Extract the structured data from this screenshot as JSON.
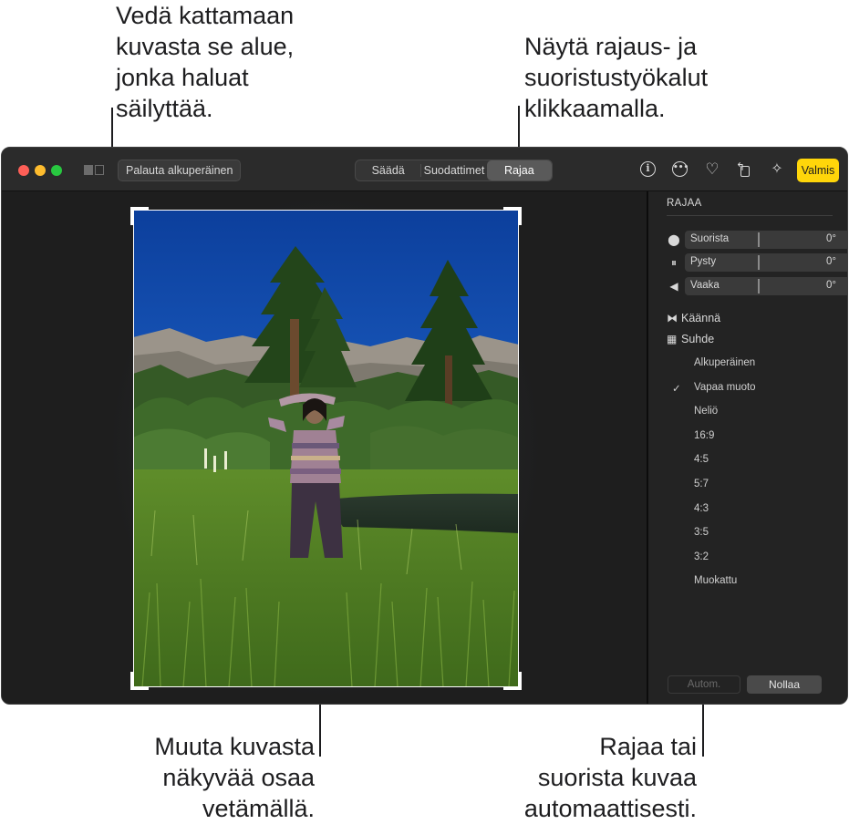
{
  "callouts": {
    "top_left": [
      "Vedä kattamaan",
      "kuvasta se alue,",
      "jonka haluat",
      "säilyttää."
    ],
    "top_right": [
      "Näytä rajaus- ja",
      "suoristustyökalut",
      "klikkaamalla."
    ],
    "bottom_left": [
      "Muuta kuvasta",
      "näkyvää osaa",
      "vetämällä."
    ],
    "bottom_right": [
      "Rajaa tai",
      "suorista kuvaa",
      "automaattisesti."
    ]
  },
  "toolbar": {
    "revert_label": "Palauta alkuperäinen",
    "tabs": [
      {
        "label": "Säädä",
        "active": false
      },
      {
        "label": "Suodattimet",
        "active": false
      },
      {
        "label": "Rajaa",
        "active": true
      }
    ],
    "icons": [
      "info-icon",
      "more-icon",
      "heart-icon",
      "rotate-icon",
      "magic-wand-icon"
    ],
    "done_label": "Valmis",
    "done_color": "#ffd60a"
  },
  "sidebar": {
    "title": "RAJAA",
    "sliders": [
      {
        "label": "Suorista",
        "value": "0°",
        "icon": "straighten-icon"
      },
      {
        "label": "Pysty",
        "value": "0°",
        "icon": "vertical-icon"
      },
      {
        "label": "Vaaka",
        "value": "0°",
        "icon": "horizontal-icon"
      }
    ],
    "flip_label": "Käännä",
    "aspect_label": "Suhde",
    "ratios": [
      "Alkuperäinen",
      "Vapaa muoto",
      "Neliö",
      "16:9",
      "4:5",
      "5:7",
      "4:3",
      "3:5",
      "3:2",
      "Muokattu"
    ],
    "selected_ratio": "Vapaa muoto",
    "checkmark": "✓",
    "auto_label": "Autom.",
    "reset_label": "Nollaa"
  }
}
